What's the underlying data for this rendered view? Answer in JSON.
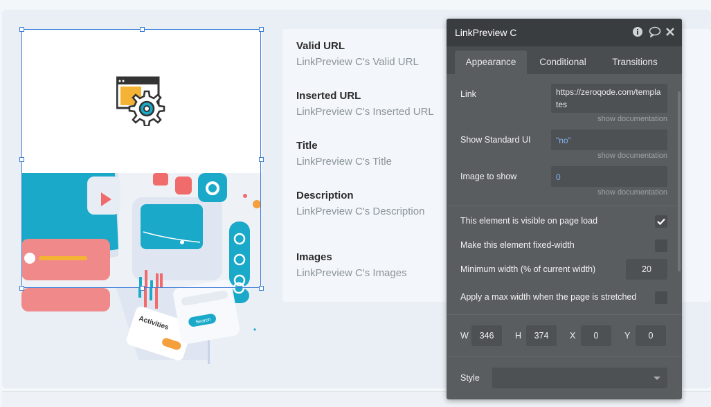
{
  "canvas": {
    "card": {
      "fields": [
        {
          "label": "Valid URL",
          "value": "LinkPreview C's Valid URL"
        },
        {
          "label": "Inserted URL",
          "value": "LinkPreview C's Inserted URL"
        },
        {
          "label": "Title",
          "value": "LinkPreview C's Title"
        },
        {
          "label": "Description",
          "value": "LinkPreview C's Description"
        },
        {
          "label": "Images",
          "value": "LinkPreview C's Images"
        }
      ]
    },
    "illustration": {
      "activities_label": "Activities",
      "search_label": "Search"
    }
  },
  "panel": {
    "title": "LinkPreview C",
    "header_icons": [
      "info-icon",
      "comment-icon",
      "close-icon"
    ],
    "tabs": [
      "Appearance",
      "Conditional",
      "Transitions"
    ],
    "active_tab": "Appearance",
    "properties": {
      "link": {
        "label": "Link",
        "value": "https://zeroqode.com/templates",
        "doc": "show documentation"
      },
      "show_standard_ui": {
        "label": "Show Standard UI",
        "value": "\"no\"",
        "doc": "show documentation"
      },
      "image_to_show": {
        "label": "Image to show",
        "value": "0",
        "doc": "show documentation"
      }
    },
    "options": {
      "visible_on_load": {
        "label": "This element is visible on page load",
        "checked": true
      },
      "fixed_width": {
        "label": "Make this element fixed-width",
        "checked": false
      },
      "min_width": {
        "label": "Minimum width (% of current width)",
        "value": "20"
      },
      "max_width": {
        "label": "Apply a max width when the page is stretched",
        "checked": false
      }
    },
    "geometry": {
      "w_label": "W",
      "w": "346",
      "h_label": "H",
      "h": "374",
      "x_label": "X",
      "x": "0",
      "y_label": "Y",
      "y": "0"
    },
    "style": {
      "label": "Style",
      "value": ""
    }
  },
  "colors": {
    "accent_teal": "#1aa9c9",
    "selection_blue": "#3b7dd8",
    "panel_bg": "#5a5d60",
    "panel_header": "#3a3d40",
    "link_blue": "#7fb2ef"
  }
}
